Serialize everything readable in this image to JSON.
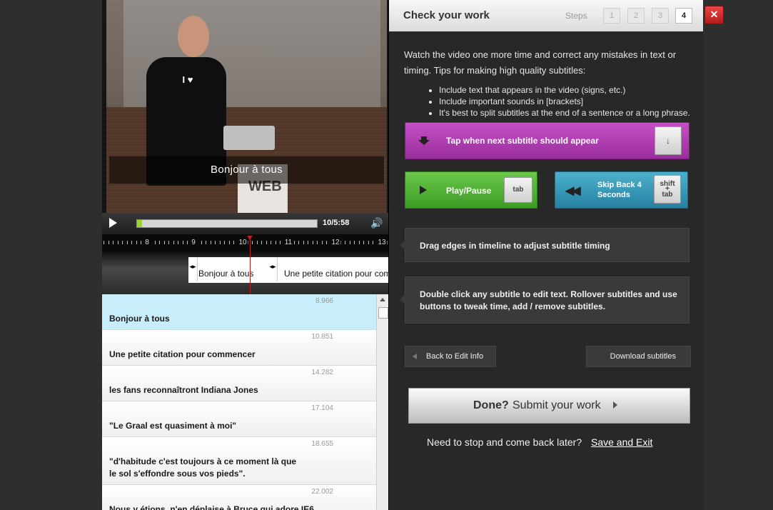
{
  "video": {
    "caption": "Bonjour à tous",
    "time_display": "10/5:58",
    "progress_fraction": 0.027,
    "shirt_text": "I ♥",
    "sign_text": "WEB"
  },
  "timeline": {
    "ticks": [
      "8",
      "9",
      "10",
      "11",
      "12",
      "13"
    ],
    "subtitles": [
      "Bonjour à tous",
      "Une petite citation pour com"
    ]
  },
  "subtitle_list": [
    {
      "time": "8.966",
      "text": "Bonjour à tous",
      "active": true
    },
    {
      "time": "10.851",
      "text": "Une petite citation pour commencer"
    },
    {
      "time": "14.282",
      "text": "les fans reconnaîtront Indiana Jones"
    },
    {
      "time": "17.104",
      "text": "\"Le Graal est quasiment à moi\""
    },
    {
      "time": "18.655",
      "text": "\"d'habitude c'est toujours à ce moment là que\nle sol s'effondre sous vos pieds\"."
    },
    {
      "time": "22.002",
      "text": "Nous y étions, n'en déplaise à Bruce qui adore IE6"
    }
  ],
  "panel": {
    "title": "Check your work",
    "steps_label": "Steps",
    "steps": [
      "1",
      "2",
      "3",
      "4"
    ],
    "current_step": "4",
    "intro": "Watch the video one more time and correct any mistakes in text or timing. Tips for making high quality subtitles:",
    "tips": [
      "Include text that appears in the video (signs, etc.)",
      "Include important sounds in [brackets]",
      "It's best to split subtitles at the end of a sentence or a long phrase."
    ],
    "tap_label": "Tap when next subtitle should appear",
    "tap_key": "↓",
    "play_label": "Play/Pause",
    "play_key": "tab",
    "skip_label": "Skip Back 4 Seconds",
    "skip_key_line1": "shift",
    "skip_key_line2": "+",
    "skip_key_line3": "tab",
    "drag_tip": "Drag edges in timeline to adjust subtitle timing",
    "edit_tip": "Double click any subtitle to edit text. Rollover subtitles and use buttons to tweak time, add / remove subtitles.",
    "back_label": "Back to Edit Info",
    "download_label": "Download subtitles",
    "done_bold": "Done?",
    "done_rest": "Submit your work",
    "stop_text": "Need to stop and come back later?",
    "save_exit": "Save and Exit"
  },
  "close_label": "✕",
  "colors": {
    "tap": "#b03fb2",
    "play": "#52b436",
    "skip": "#3797b8",
    "close": "#d42a2a",
    "progress": "#9ccf3a",
    "active_row": "#c9eefb"
  }
}
